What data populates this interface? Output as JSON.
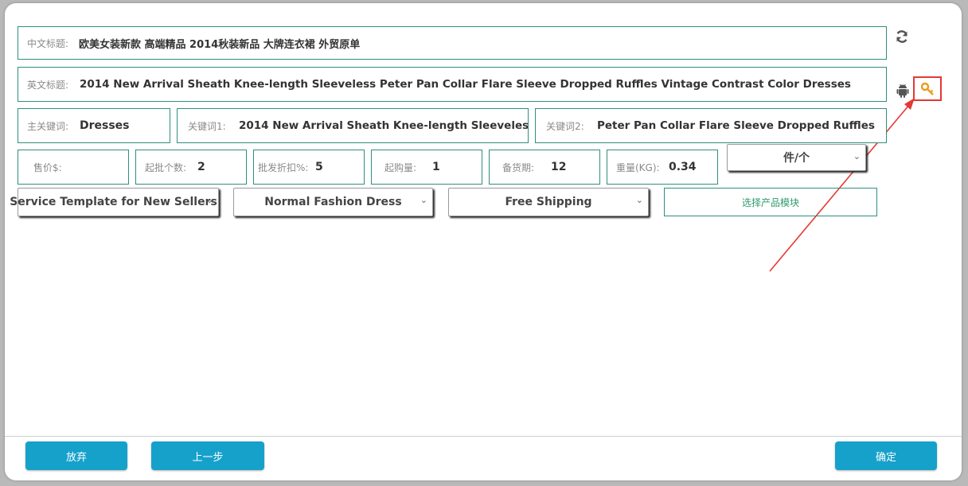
{
  "title_cn": {
    "label": "中文标题:",
    "value": "欧美女装新款 高端精品 2014秋装新品 大牌连衣裙 外贸原单"
  },
  "title_en": {
    "label": "英文标题:",
    "value": "2014 New Arrival Sheath Knee-length Sleeveless Peter Pan Collar Flare Sleeve Dropped Ruffles Vintage Contrast Color Dresses"
  },
  "keywords": {
    "main": {
      "label": "主关键词:",
      "value": "Dresses"
    },
    "k1": {
      "label": "关键词1:",
      "value": "2014 New Arrival Sheath Knee-length Sleeveless"
    },
    "k2": {
      "label": "关键词2:",
      "value": "Peter Pan Collar Flare Sleeve Dropped Ruffles"
    }
  },
  "pricing": {
    "price": {
      "label": "售价$:",
      "value": ""
    },
    "min_batch": {
      "label": "起批个数:",
      "value": "2"
    },
    "discount": {
      "label": "批发折扣%:",
      "value": "5"
    },
    "min_order": {
      "label": "起购量:",
      "value": "1"
    },
    "lead_time": {
      "label": "备货期:",
      "value": "12"
    },
    "weight": {
      "label": "重量(KG):",
      "value": "0.34"
    },
    "unit": "件/个"
  },
  "selects": {
    "service": "Service Template for New Sellers",
    "category": "Normal Fashion Dress",
    "shipping": "Free Shipping"
  },
  "module_button": "选择产品模块",
  "icons": {
    "refresh": "refresh-icon",
    "android": "android-icon",
    "key": "key-icon"
  },
  "colors": {
    "field_border": "#2f8f7c",
    "button_bg": "#16a1cb",
    "module_text": "#2f9a6c",
    "highlight": "#e53935"
  },
  "footer": {
    "abandon": "放弃",
    "previous": "上一步",
    "confirm": "确定"
  }
}
